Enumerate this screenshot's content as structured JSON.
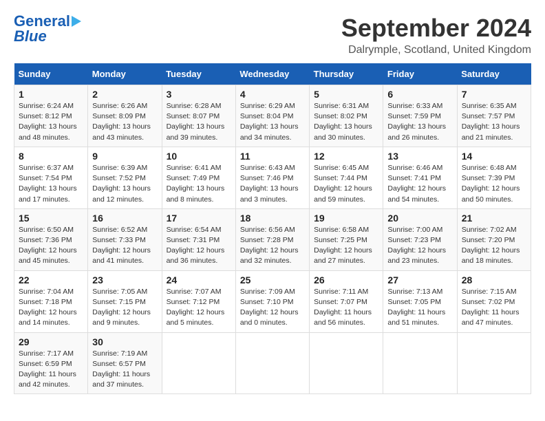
{
  "header": {
    "logo_line1": "General",
    "logo_line2": "Blue",
    "title": "September 2024",
    "subtitle": "Dalrymple, Scotland, United Kingdom"
  },
  "columns": [
    "Sunday",
    "Monday",
    "Tuesday",
    "Wednesday",
    "Thursday",
    "Friday",
    "Saturday"
  ],
  "weeks": [
    [
      {
        "day": "1",
        "info": "Sunrise: 6:24 AM\nSunset: 8:12 PM\nDaylight: 13 hours\nand 48 minutes."
      },
      {
        "day": "2",
        "info": "Sunrise: 6:26 AM\nSunset: 8:09 PM\nDaylight: 13 hours\nand 43 minutes."
      },
      {
        "day": "3",
        "info": "Sunrise: 6:28 AM\nSunset: 8:07 PM\nDaylight: 13 hours\nand 39 minutes."
      },
      {
        "day": "4",
        "info": "Sunrise: 6:29 AM\nSunset: 8:04 PM\nDaylight: 13 hours\nand 34 minutes."
      },
      {
        "day": "5",
        "info": "Sunrise: 6:31 AM\nSunset: 8:02 PM\nDaylight: 13 hours\nand 30 minutes."
      },
      {
        "day": "6",
        "info": "Sunrise: 6:33 AM\nSunset: 7:59 PM\nDaylight: 13 hours\nand 26 minutes."
      },
      {
        "day": "7",
        "info": "Sunrise: 6:35 AM\nSunset: 7:57 PM\nDaylight: 13 hours\nand 21 minutes."
      }
    ],
    [
      {
        "day": "8",
        "info": "Sunrise: 6:37 AM\nSunset: 7:54 PM\nDaylight: 13 hours\nand 17 minutes."
      },
      {
        "day": "9",
        "info": "Sunrise: 6:39 AM\nSunset: 7:52 PM\nDaylight: 13 hours\nand 12 minutes."
      },
      {
        "day": "10",
        "info": "Sunrise: 6:41 AM\nSunset: 7:49 PM\nDaylight: 13 hours\nand 8 minutes."
      },
      {
        "day": "11",
        "info": "Sunrise: 6:43 AM\nSunset: 7:46 PM\nDaylight: 13 hours\nand 3 minutes."
      },
      {
        "day": "12",
        "info": "Sunrise: 6:45 AM\nSunset: 7:44 PM\nDaylight: 12 hours\nand 59 minutes."
      },
      {
        "day": "13",
        "info": "Sunrise: 6:46 AM\nSunset: 7:41 PM\nDaylight: 12 hours\nand 54 minutes."
      },
      {
        "day": "14",
        "info": "Sunrise: 6:48 AM\nSunset: 7:39 PM\nDaylight: 12 hours\nand 50 minutes."
      }
    ],
    [
      {
        "day": "15",
        "info": "Sunrise: 6:50 AM\nSunset: 7:36 PM\nDaylight: 12 hours\nand 45 minutes."
      },
      {
        "day": "16",
        "info": "Sunrise: 6:52 AM\nSunset: 7:33 PM\nDaylight: 12 hours\nand 41 minutes."
      },
      {
        "day": "17",
        "info": "Sunrise: 6:54 AM\nSunset: 7:31 PM\nDaylight: 12 hours\nand 36 minutes."
      },
      {
        "day": "18",
        "info": "Sunrise: 6:56 AM\nSunset: 7:28 PM\nDaylight: 12 hours\nand 32 minutes."
      },
      {
        "day": "19",
        "info": "Sunrise: 6:58 AM\nSunset: 7:25 PM\nDaylight: 12 hours\nand 27 minutes."
      },
      {
        "day": "20",
        "info": "Sunrise: 7:00 AM\nSunset: 7:23 PM\nDaylight: 12 hours\nand 23 minutes."
      },
      {
        "day": "21",
        "info": "Sunrise: 7:02 AM\nSunset: 7:20 PM\nDaylight: 12 hours\nand 18 minutes."
      }
    ],
    [
      {
        "day": "22",
        "info": "Sunrise: 7:04 AM\nSunset: 7:18 PM\nDaylight: 12 hours\nand 14 minutes."
      },
      {
        "day": "23",
        "info": "Sunrise: 7:05 AM\nSunset: 7:15 PM\nDaylight: 12 hours\nand 9 minutes."
      },
      {
        "day": "24",
        "info": "Sunrise: 7:07 AM\nSunset: 7:12 PM\nDaylight: 12 hours\nand 5 minutes."
      },
      {
        "day": "25",
        "info": "Sunrise: 7:09 AM\nSunset: 7:10 PM\nDaylight: 12 hours\nand 0 minutes."
      },
      {
        "day": "26",
        "info": "Sunrise: 7:11 AM\nSunset: 7:07 PM\nDaylight: 11 hours\nand 56 minutes."
      },
      {
        "day": "27",
        "info": "Sunrise: 7:13 AM\nSunset: 7:05 PM\nDaylight: 11 hours\nand 51 minutes."
      },
      {
        "day": "28",
        "info": "Sunrise: 7:15 AM\nSunset: 7:02 PM\nDaylight: 11 hours\nand 47 minutes."
      }
    ],
    [
      {
        "day": "29",
        "info": "Sunrise: 7:17 AM\nSunset: 6:59 PM\nDaylight: 11 hours\nand 42 minutes."
      },
      {
        "day": "30",
        "info": "Sunrise: 7:19 AM\nSunset: 6:57 PM\nDaylight: 11 hours\nand 37 minutes."
      },
      {
        "day": "",
        "info": ""
      },
      {
        "day": "",
        "info": ""
      },
      {
        "day": "",
        "info": ""
      },
      {
        "day": "",
        "info": ""
      },
      {
        "day": "",
        "info": ""
      }
    ]
  ]
}
